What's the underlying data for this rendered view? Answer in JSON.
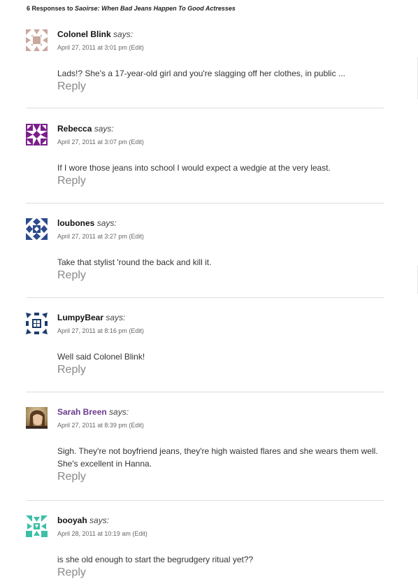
{
  "heading": {
    "prefix": "6 Responses to",
    "title": "Saoirse: When Bad Jeans Happen To Good Actresses"
  },
  "says_label": "says:",
  "reply_label": "Reply",
  "edit_label": "(Edit)",
  "comments": [
    {
      "author": "Colonel Blink",
      "date": "April 27, 2011 at 3:01 pm",
      "text": "Lads!? She's a 17-year-old girl and you're slagging off her clothes, in public ...",
      "avatar_color": "#c9a89e"
    },
    {
      "author": "Rebecca",
      "date": "April 27, 2011 at 3:07 pm",
      "text": "If I wore those jeans into school I would expect a wedgie at the very least.",
      "avatar_color": "#7b1f8c"
    },
    {
      "author": "loubones",
      "date": "April 27, 2011 at 3:27 pm",
      "text": "Take that stylist 'round the back and kill it.",
      "avatar_color": "#2c4c8c"
    },
    {
      "author": "LumpyBear",
      "date": "April 27, 2011 at 8:16 pm",
      "text": "Well said Colonel Blink!",
      "avatar_color": "#1c3c6c"
    },
    {
      "author": "Sarah Breen",
      "date": "April 27, 2011 at 8:39 pm",
      "text": "Sigh. They're not boyfriend jeans, they're high waisted flares and she wears them well. She's excellent in Hanna.",
      "avatar_color": "#b58a6a",
      "author_is_link": true
    },
    {
      "author": "booyah",
      "date": "April 28, 2011 at 10:19 am",
      "text": "is she old enough to start the begrudgery ritual yet??",
      "avatar_color": "#3cbfa6"
    }
  ]
}
